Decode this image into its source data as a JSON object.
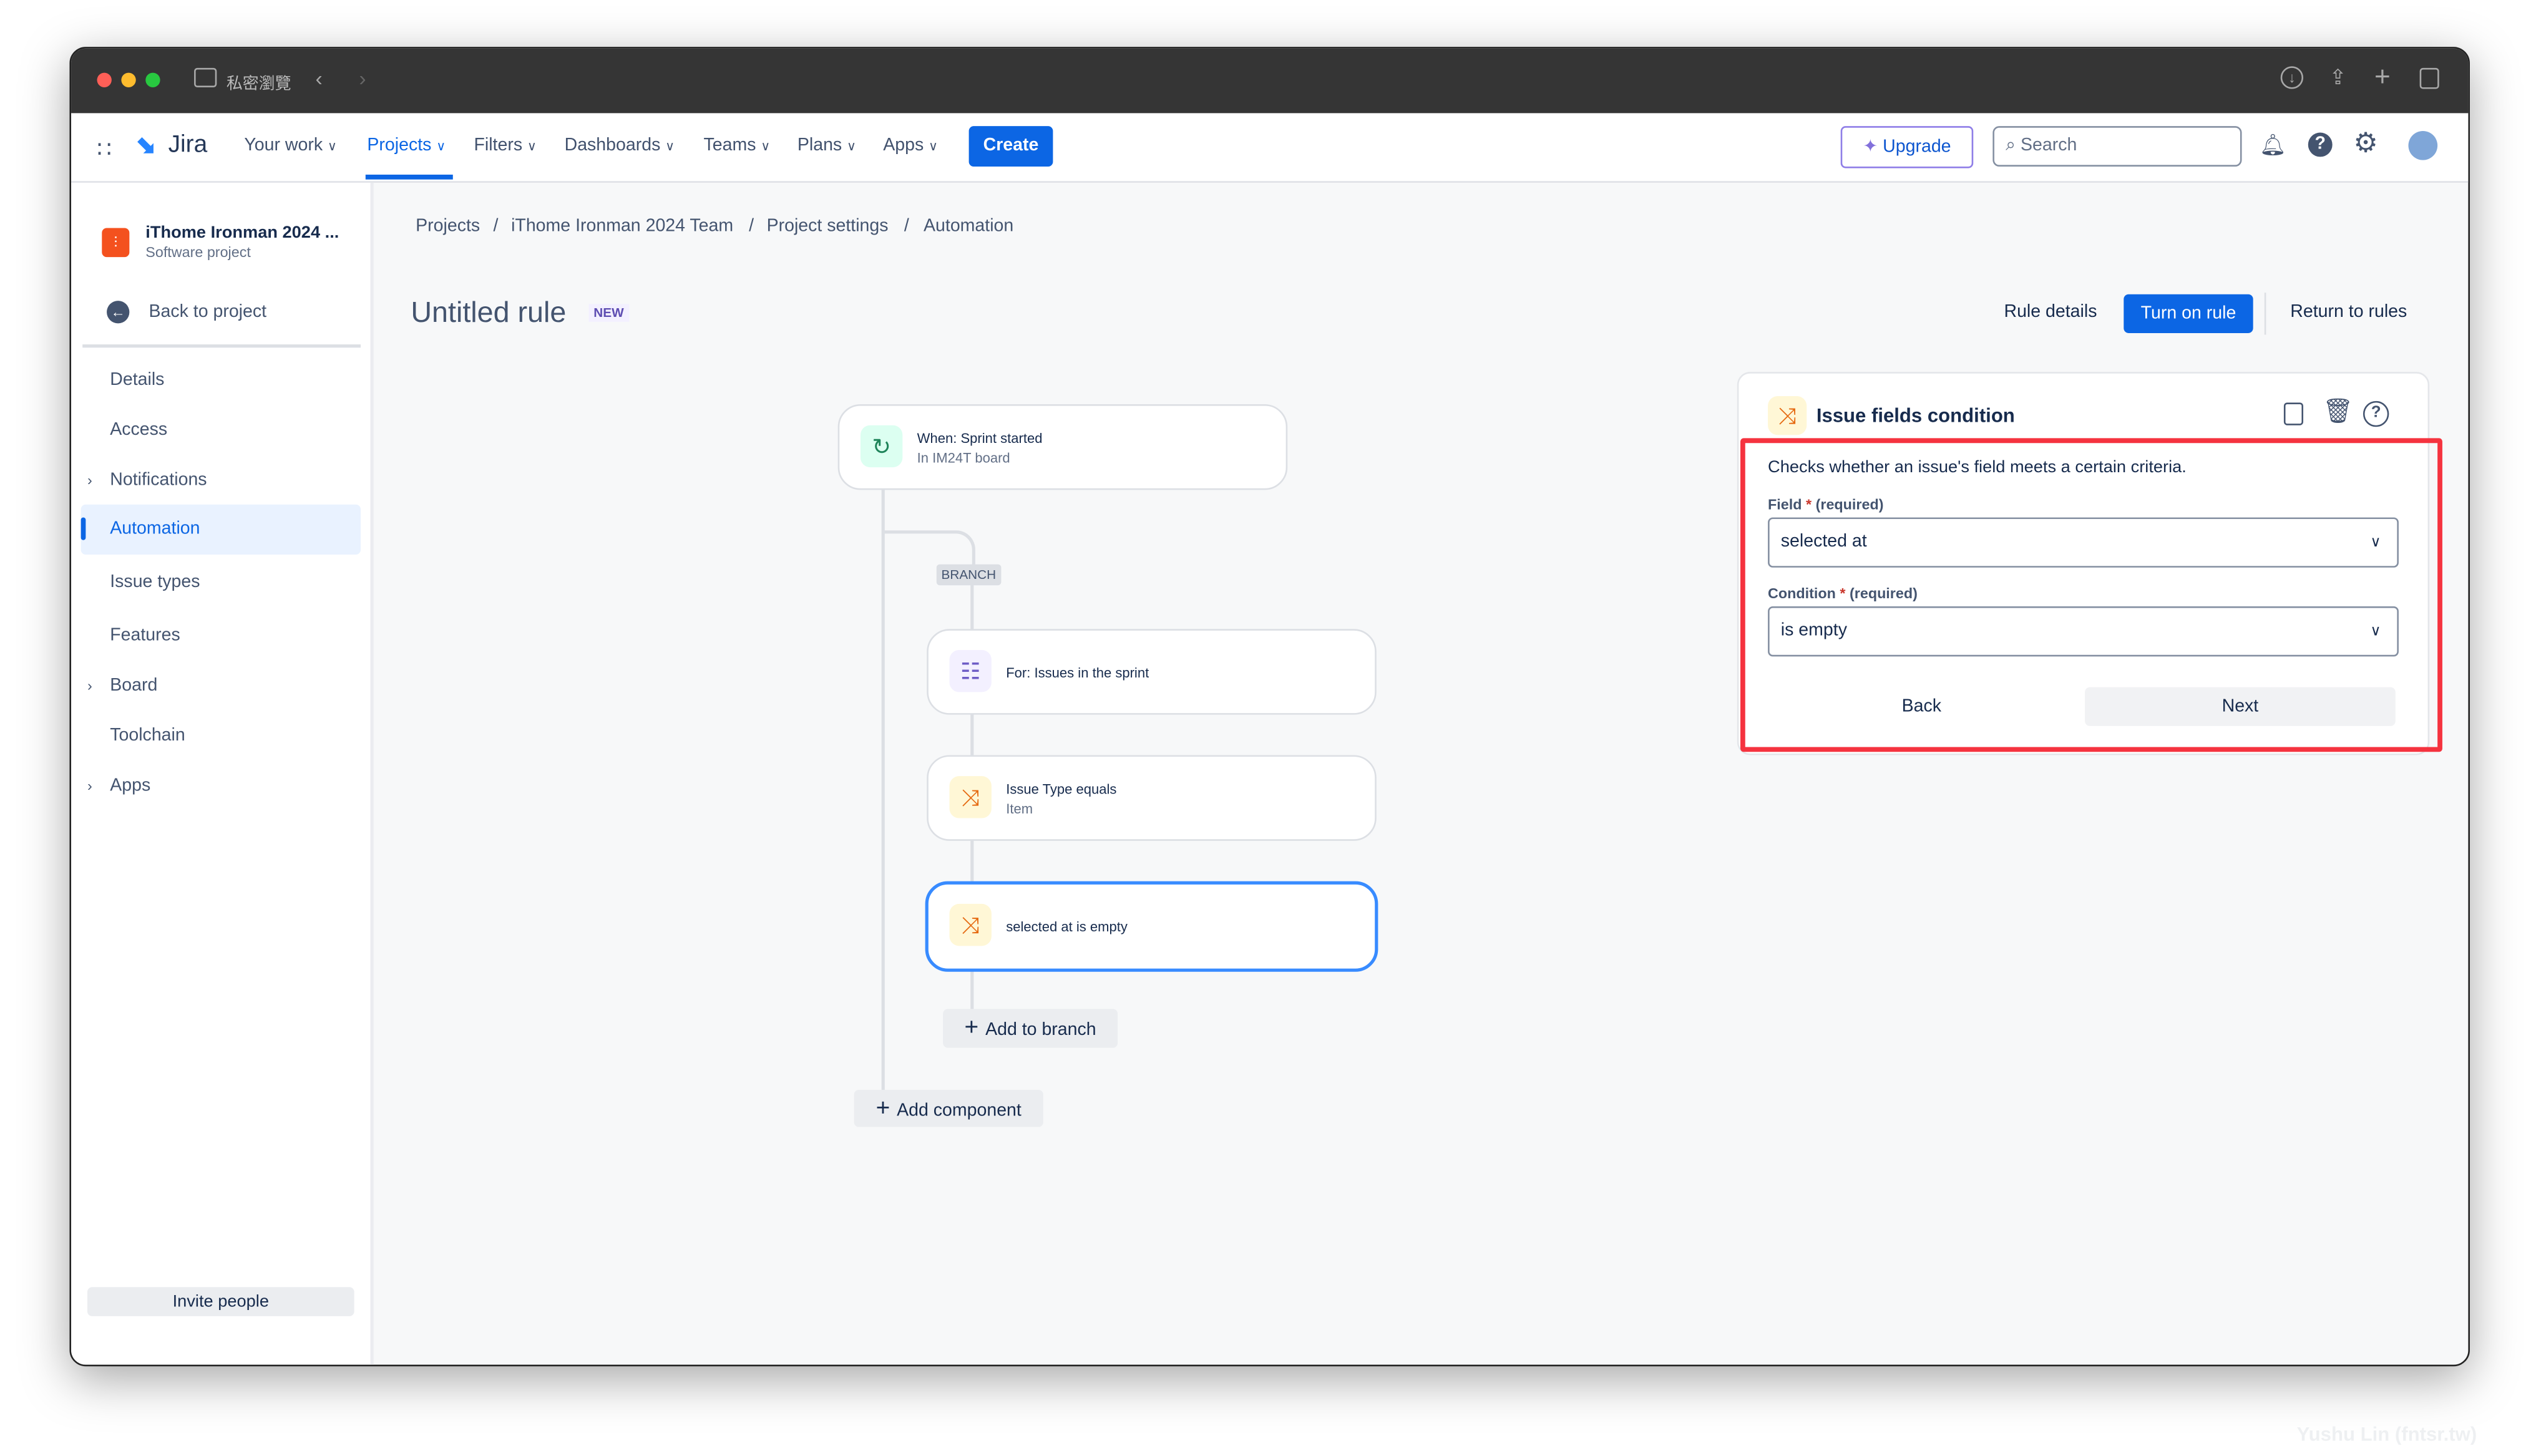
{
  "browser": {
    "tab_label": "私密瀏覽",
    "icons": [
      "sidebar-icon",
      "back-icon",
      "forward-icon",
      "download-icon",
      "share-icon",
      "new-tab-icon",
      "tabs-overview-icon"
    ]
  },
  "nav": {
    "brand": "Jira",
    "items": [
      {
        "label": "Your work"
      },
      {
        "label": "Projects",
        "active": true
      },
      {
        "label": "Filters"
      },
      {
        "label": "Dashboards"
      },
      {
        "label": "Teams"
      },
      {
        "label": "Plans"
      },
      {
        "label": "Apps"
      }
    ],
    "create": "Create",
    "upgrade": "Upgrade",
    "search_placeholder": "Search",
    "accent": "#0c66e4"
  },
  "sidebar": {
    "project_name": "iThome Ironman 2024 ...",
    "project_type": "Software project",
    "back": "Back to project",
    "items": [
      {
        "label": "Details"
      },
      {
        "label": "Access"
      },
      {
        "label": "Notifications",
        "expandable": true
      },
      {
        "label": "Automation",
        "selected": true
      },
      {
        "label": "Issue types"
      },
      {
        "label": "Features"
      },
      {
        "label": "Board",
        "expandable": true
      },
      {
        "label": "Toolchain"
      },
      {
        "label": "Apps",
        "expandable": true
      }
    ],
    "invite": "Invite people"
  },
  "breadcrumb": [
    "Projects",
    "iThome Ironman 2024 Team",
    "Project settings",
    "Automation"
  ],
  "header": {
    "title": "Untitled rule",
    "badge": "NEW",
    "rule_details": "Rule details",
    "turn_on": "Turn on rule",
    "return": "Return to rules"
  },
  "flow": {
    "trigger": {
      "title": "When: Sprint started",
      "sub": "In IM24T board"
    },
    "branch_label": "BRANCH",
    "branch_nodes": [
      {
        "title": "For: Issues in the sprint",
        "sub": ""
      },
      {
        "title": "Issue Type equals",
        "sub": "Item"
      },
      {
        "title": "selected at is empty",
        "sub": "",
        "selected": true
      }
    ],
    "add_to_branch": "Add to branch",
    "add_component": "Add component"
  },
  "panel": {
    "title": "Issue fields condition",
    "description": "Checks whether an issue's field meets a certain criteria.",
    "field_label": "Field",
    "condition_label": "Condition",
    "required": "(required)",
    "field_value": "selected at",
    "condition_value": "is empty",
    "back": "Back",
    "next": "Next",
    "highlight_color": "#f5333f"
  },
  "watermark": "Yushu Lin (fntsr.tw)"
}
